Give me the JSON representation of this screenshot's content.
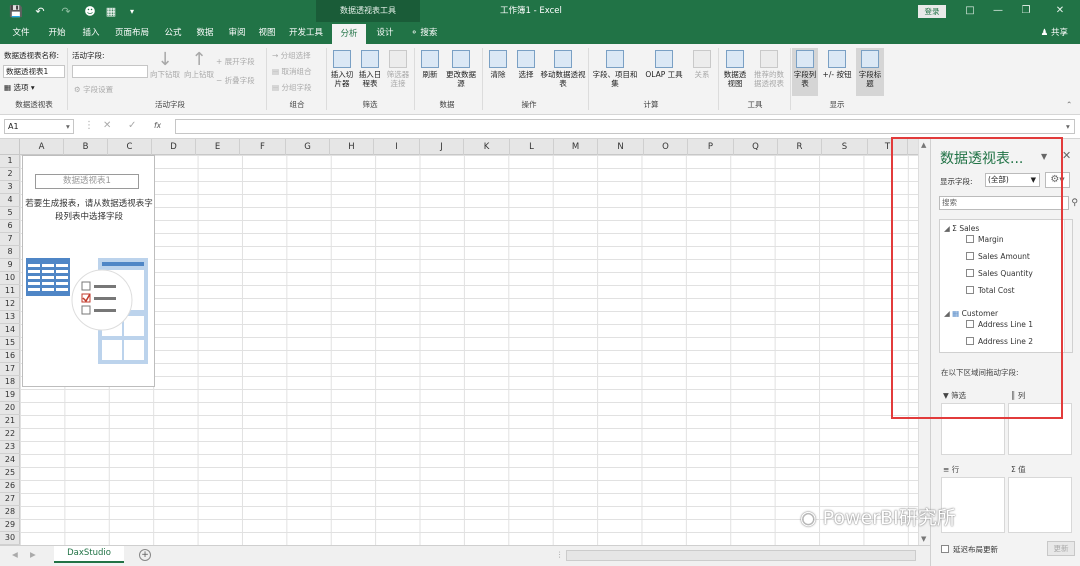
{
  "titlebar": {
    "contextual": "数据透视表工具",
    "title": "工作簿1 - Excel",
    "login": "登录"
  },
  "tabs": [
    "文件",
    "开始",
    "插入",
    "页面布局",
    "公式",
    "数据",
    "审阅",
    "视图",
    "开发工具",
    "分析",
    "设计"
  ],
  "tell_me": "搜索",
  "share": "共享",
  "ribbon": {
    "pt_name_label": "数据透视表名称:",
    "pt_name_value": "数据透视表1",
    "options": "选项",
    "active_field_label": "活动字段:",
    "field_settings": "字段设置",
    "drill_down": "向下钻取",
    "drill_up": "向上钻取",
    "expand_field": "展开字段",
    "collapse_field": "折叠字段",
    "group_selection": "分组选择",
    "ungroup": "取消组合",
    "group_field": "分组字段",
    "insert_slicer": "插入切片器",
    "insert_timeline": "插入日程表",
    "filter_connections": "筛选器连接",
    "refresh": "刷新",
    "change_source": "更改数据源",
    "clear": "清除",
    "select": "选择",
    "move_pivot": "移动数据透视表",
    "fields_items_sets": "字段、项目和集",
    "olap_tools": "OLAP 工具",
    "relationships": "关系",
    "pivot_chart": "数据透视图",
    "recommended_pivot": "推荐的数据透视表",
    "field_list": "字段列表",
    "buttons": "+/- 按钮",
    "field_headers": "字段标题",
    "groups": {
      "pivot": "数据透视表",
      "active_field": "活动字段",
      "group": "组合",
      "filter": "筛选",
      "data": "数据",
      "actions": "操作",
      "calc": "计算",
      "tools": "工具",
      "show": "显示"
    }
  },
  "formula_bar": {
    "name_box": "A1",
    "fx": "fx"
  },
  "columns": [
    "A",
    "B",
    "C",
    "D",
    "E",
    "F",
    "G",
    "H",
    "I",
    "J",
    "K",
    "L",
    "M",
    "N",
    "O",
    "P",
    "Q",
    "R",
    "S",
    "T"
  ],
  "rows": [
    "1",
    "2",
    "3",
    "4",
    "5",
    "6",
    "7",
    "8",
    "9",
    "10",
    "11",
    "12",
    "13",
    "14",
    "15",
    "16",
    "17",
    "18",
    "19",
    "20",
    "21",
    "22",
    "23",
    "24",
    "25",
    "26",
    "27",
    "28",
    "29",
    "30"
  ],
  "placeholder": {
    "title": "数据透视表1",
    "message": "若要生成报表，请从数据透视表字段列表中选择字段"
  },
  "sheet_tab": "DaxStudio",
  "pane": {
    "title": "数据透视表...",
    "show_fields_label": "显示字段:",
    "show_fields_value": "(全部)",
    "search_placeholder": "搜索",
    "tables": [
      {
        "name": "Sales",
        "fields": [
          "Margin",
          "Sales Amount",
          "Sales Quantity",
          "Total Cost"
        ]
      },
      {
        "name": "Customer",
        "fields": [
          "Address Line 1",
          "Address Line 2"
        ]
      }
    ],
    "drag_msg": "在以下区域间拖动字段:",
    "areas": {
      "filters": "筛选",
      "columns": "列",
      "rows": "行",
      "values": "值"
    },
    "defer_label": "延迟布局更新",
    "update_button": "更新"
  },
  "watermark": "PowerBI研究所",
  "colors": {
    "accent": "#217346",
    "highlight_box": "#e23b3b"
  }
}
